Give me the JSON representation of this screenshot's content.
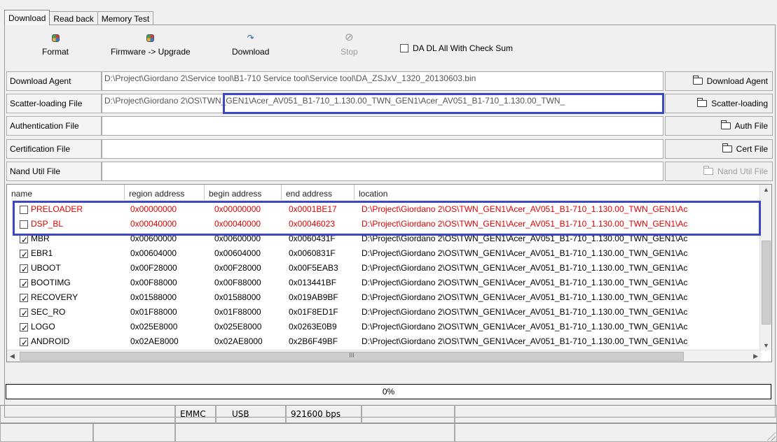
{
  "tabs": [
    "Download",
    "Read back",
    "Memory Test"
  ],
  "toolbar": {
    "format": "Format",
    "firmware_upgrade": "Firmware -> Upgrade",
    "download": "Download",
    "stop": "Stop",
    "checksum_label": "DA DL All With Check Sum"
  },
  "files": {
    "download_agent": {
      "label": "Download Agent",
      "value": "D:\\Project\\Giordano 2\\Service tool\\B1-710 Service tool\\Service tool\\DA_ZSJxV_1320_20130603.bin",
      "button": "Download Agent"
    },
    "scatter": {
      "label": "Scatter-loading File",
      "value": "D:\\Project\\Giordano 2\\OS\\TWN_GEN1\\Acer_AV051_B1-710_1.130.00_TWN_GEN1\\Acer_AV051_B1-710_1.130.00_TWN_",
      "button": "Scatter-loading"
    },
    "auth": {
      "label": "Authentication File",
      "value": "",
      "button": "Auth File"
    },
    "cert": {
      "label": "Certification File",
      "value": "",
      "button": "Cert File"
    },
    "nand": {
      "label": "Nand Util File",
      "value": "",
      "button": "Nand Util File"
    }
  },
  "list": {
    "headers": [
      "name",
      "region address",
      "begin address",
      "end address",
      "location"
    ],
    "rows": [
      {
        "checked": false,
        "name": "PRELOADER",
        "region": "0x00000000",
        "begin": "0x00000000",
        "end": "0x0001BE17",
        "location": "D:\\Project\\Giordano 2\\OS\\TWN_GEN1\\Acer_AV051_B1-710_1.130.00_TWN_GEN1\\Ac"
      },
      {
        "checked": false,
        "name": "DSP_BL",
        "region": "0x00040000",
        "begin": "0x00040000",
        "end": "0x00046023",
        "location": "D:\\Project\\Giordano 2\\OS\\TWN_GEN1\\Acer_AV051_B1-710_1.130.00_TWN_GEN1\\Ac"
      },
      {
        "checked": true,
        "name": "MBR",
        "region": "0x00600000",
        "begin": "0x00600000",
        "end": "0x0060431F",
        "location": "D:\\Project\\Giordano 2\\OS\\TWN_GEN1\\Acer_AV051_B1-710_1.130.00_TWN_GEN1\\Ac"
      },
      {
        "checked": true,
        "name": "EBR1",
        "region": "0x00604000",
        "begin": "0x00604000",
        "end": "0x0060831F",
        "location": "D:\\Project\\Giordano 2\\OS\\TWN_GEN1\\Acer_AV051_B1-710_1.130.00_TWN_GEN1\\Ac"
      },
      {
        "checked": true,
        "name": "UBOOT",
        "region": "0x00F28000",
        "begin": "0x00F28000",
        "end": "0x00F5EAB3",
        "location": "D:\\Project\\Giordano 2\\OS\\TWN_GEN1\\Acer_AV051_B1-710_1.130.00_TWN_GEN1\\Ac"
      },
      {
        "checked": true,
        "name": "BOOTIMG",
        "region": "0x00F88000",
        "begin": "0x00F88000",
        "end": "0x013441BF",
        "location": "D:\\Project\\Giordano 2\\OS\\TWN_GEN1\\Acer_AV051_B1-710_1.130.00_TWN_GEN1\\Ac"
      },
      {
        "checked": true,
        "name": "RECOVERY",
        "region": "0x01588000",
        "begin": "0x01588000",
        "end": "0x019AB9BF",
        "location": "D:\\Project\\Giordano 2\\OS\\TWN_GEN1\\Acer_AV051_B1-710_1.130.00_TWN_GEN1\\Ac"
      },
      {
        "checked": true,
        "name": "SEC_RO",
        "region": "0x01F88000",
        "begin": "0x01F88000",
        "end": "0x01F8ED1F",
        "location": "D:\\Project\\Giordano 2\\OS\\TWN_GEN1\\Acer_AV051_B1-710_1.130.00_TWN_GEN1\\Ac"
      },
      {
        "checked": true,
        "name": "LOGO",
        "region": "0x025E8000",
        "begin": "0x025E8000",
        "end": "0x0263E0B9",
        "location": "D:\\Project\\Giordano 2\\OS\\TWN_GEN1\\Acer_AV051_B1-710_1.130.00_TWN_GEN1\\Ac"
      },
      {
        "checked": true,
        "name": "ANDROID",
        "region": "0x02AE8000",
        "begin": "0x02AE8000",
        "end": "0x2B6F49BF",
        "location": "D:\\Project\\Giordano 2\\OS\\TWN_GEN1\\Acer_AV051_B1-710_1.130.00_TWN_GEN1\\Ac"
      }
    ],
    "hscroll_grip": "III"
  },
  "progress": {
    "text": "0%",
    "value": 0
  },
  "status": {
    "storage": "EMMC",
    "port": "USB",
    "baud": "921600 bps"
  },
  "colors": {
    "highlight": "#3c47c6",
    "unchecked_row": "#e00000"
  }
}
